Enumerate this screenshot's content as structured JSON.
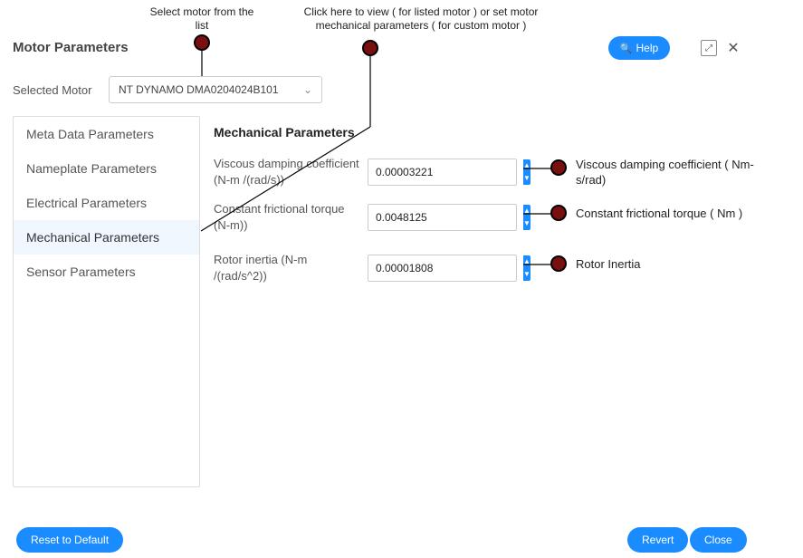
{
  "annotations": {
    "top1": "Select motor from the list",
    "top2": "Click here to view ( for listed motor ) or set motor mechanical parameters ( for custom motor )",
    "r1": "Viscous damping coefficient ( Nm-s/rad)",
    "r2": "Constant frictional torque ( Nm )",
    "r3": "Rotor Inertia"
  },
  "header": {
    "title": "Motor Parameters",
    "help_label": "Help"
  },
  "selector": {
    "label": "Selected Motor",
    "value": "NT DYNAMO DMA0204024B101"
  },
  "sidebar": {
    "items": [
      {
        "label": "Meta Data Parameters"
      },
      {
        "label": "Nameplate Parameters"
      },
      {
        "label": "Electrical Parameters"
      },
      {
        "label": "Mechanical Parameters"
      },
      {
        "label": "Sensor Parameters"
      }
    ],
    "active_index": 3
  },
  "panel": {
    "title": "Mechanical Parameters",
    "rows": [
      {
        "label": "Viscous damping coefficient (N-m /(rad/s))",
        "value": "0.00003221"
      },
      {
        "label": "Constant frictional torque (N-m))",
        "value": "0.0048125"
      },
      {
        "label": "Rotor inertia (N-m /(rad/s^2))",
        "value": "0.00001808"
      }
    ]
  },
  "footer": {
    "reset": "Reset to Default",
    "revert": "Revert",
    "close": "Close"
  }
}
